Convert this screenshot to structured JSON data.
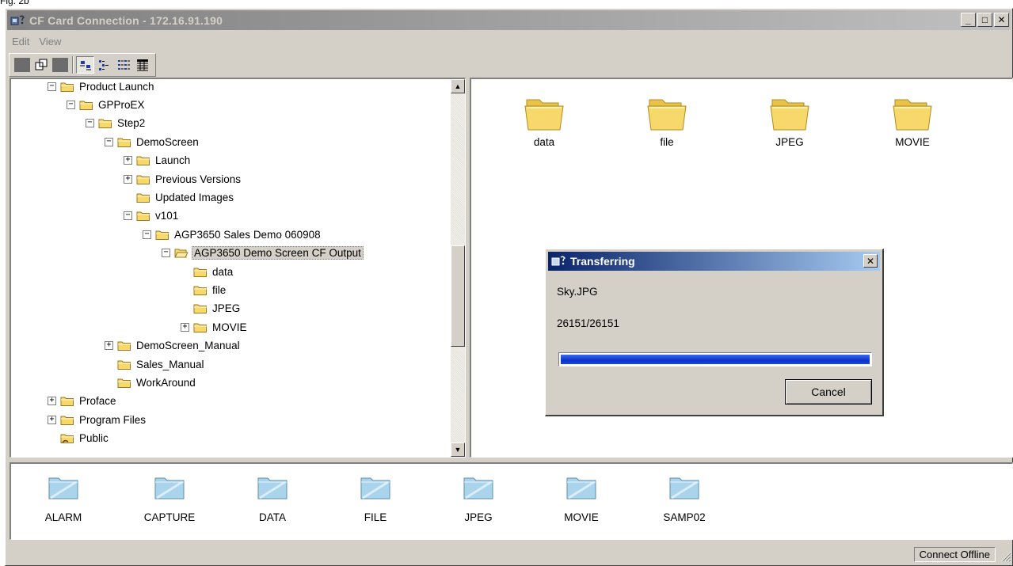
{
  "figure_label": "Fig. 2b",
  "window": {
    "title": "CF Card Connection - 172.16.91.190",
    "minimize_glyph": "_",
    "maximize_glyph": "□",
    "close_glyph": "✕"
  },
  "menu": {
    "items": [
      {
        "label": "Edit"
      },
      {
        "label": "View"
      }
    ]
  },
  "toolbar": {
    "icons": [
      "grey-block-icon",
      "copy-icon",
      "grey-block-icon",
      "large-icons-view-icon",
      "small-icons-view-icon",
      "list-view-icon",
      "details-view-icon"
    ],
    "pressed": "large-icons-view-icon"
  },
  "tree": {
    "items": [
      {
        "label": "Product Launch",
        "level": 0,
        "expander": "⊟"
      },
      {
        "label": "GPProEX",
        "level": 1,
        "expander": "⊟"
      },
      {
        "label": "Step2",
        "level": 2,
        "expander": "⊟"
      },
      {
        "label": "DemoScreen",
        "level": 3,
        "expander": "⊟"
      },
      {
        "label": "Launch",
        "level": 4,
        "expander": "⊞"
      },
      {
        "label": "Previous Versions",
        "level": 4,
        "expander": "⊞"
      },
      {
        "label": "Updated Images",
        "level": 4,
        "expander": ""
      },
      {
        "label": "v101",
        "level": 4,
        "expander": "⊟"
      },
      {
        "label": "AGP3650 Sales Demo 060908",
        "level": 5,
        "expander": "⊟"
      },
      {
        "label": "AGP3650 Demo Screen CF Output",
        "level": 6,
        "expander": "⊟",
        "selected": true,
        "open": true
      },
      {
        "label": "data",
        "level": 7,
        "expander": ""
      },
      {
        "label": "file",
        "level": 7,
        "expander": ""
      },
      {
        "label": "JPEG",
        "level": 7,
        "expander": ""
      },
      {
        "label": "MOVIE",
        "level": 7,
        "expander": "⊞"
      },
      {
        "label": "DemoScreen_Manual",
        "level": 3,
        "expander": "⊞"
      },
      {
        "label": "Sales_Manual",
        "level": 3,
        "expander": ""
      },
      {
        "label": "WorkAround",
        "level": 3,
        "expander": ""
      },
      {
        "label": "Proface",
        "level": 0,
        "expander": "⊞"
      },
      {
        "label": "Program Files",
        "level": 0,
        "expander": "⊞"
      },
      {
        "label": "Public",
        "level": 0,
        "expander": "",
        "shared": true
      }
    ]
  },
  "folder_view": {
    "items": [
      {
        "label": "data"
      },
      {
        "label": "file"
      },
      {
        "label": "JPEG"
      },
      {
        "label": "MOVIE"
      }
    ]
  },
  "card_view": {
    "items": [
      {
        "label": "ALARM"
      },
      {
        "label": "CAPTURE"
      },
      {
        "label": "DATA"
      },
      {
        "label": "FILE"
      },
      {
        "label": "JPEG"
      },
      {
        "label": "MOVIE"
      },
      {
        "label": "SAMP02"
      }
    ]
  },
  "status": {
    "connection": "Connect Offline"
  },
  "dialog": {
    "title": "Transferring",
    "file_name": "Sky.JPG",
    "progress_text": "26151/26151",
    "progress_fraction": 1.0,
    "cancel_label": "Cancel",
    "close_glyph": "✕"
  },
  "colors": {
    "window_bg": "#d4d0c8",
    "inactive_title": "#808080",
    "active_title": "#0a246a",
    "progress": "#0a32c8",
    "folder_yellow": "#f7d86b",
    "card_folder_blue": "#a9d4ec"
  }
}
